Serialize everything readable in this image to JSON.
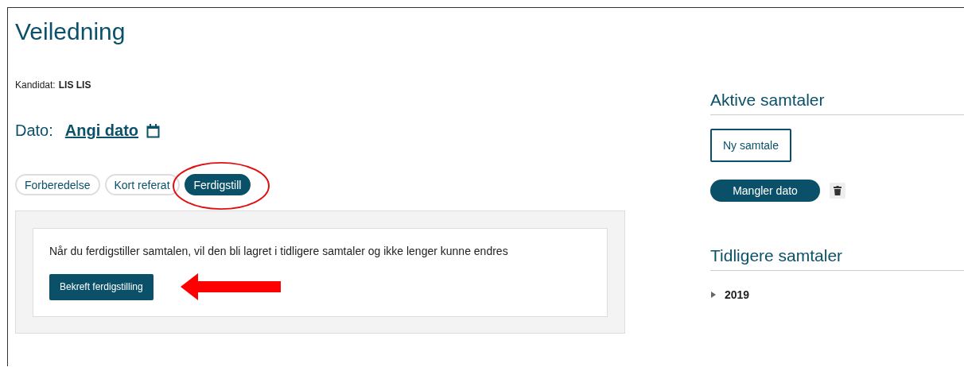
{
  "title": "Veiledning",
  "candidate": {
    "label": "Kandidat:",
    "name": "LIS LIS"
  },
  "date": {
    "label": "Dato:",
    "link": "Angi dato"
  },
  "tabs": [
    {
      "label": "Forberedelse",
      "selected": false,
      "circled": false
    },
    {
      "label": "Kort referat",
      "selected": false,
      "circled": false
    },
    {
      "label": "Ferdigstill",
      "selected": true,
      "circled": true
    }
  ],
  "panel": {
    "message": "Når du ferdigstiller samtalen, vil den bli lagret i tidligere samtaler og ikke lenger kunne endres",
    "button": "Bekreft ferdigstilling"
  },
  "active": {
    "heading": "Aktive samtaler",
    "new_button": "Ny samtale",
    "items": [
      {
        "label": "Mangler dato"
      }
    ]
  },
  "previous": {
    "heading": "Tidligere samtaler",
    "years": [
      {
        "label": "2019",
        "expanded": false
      }
    ]
  }
}
